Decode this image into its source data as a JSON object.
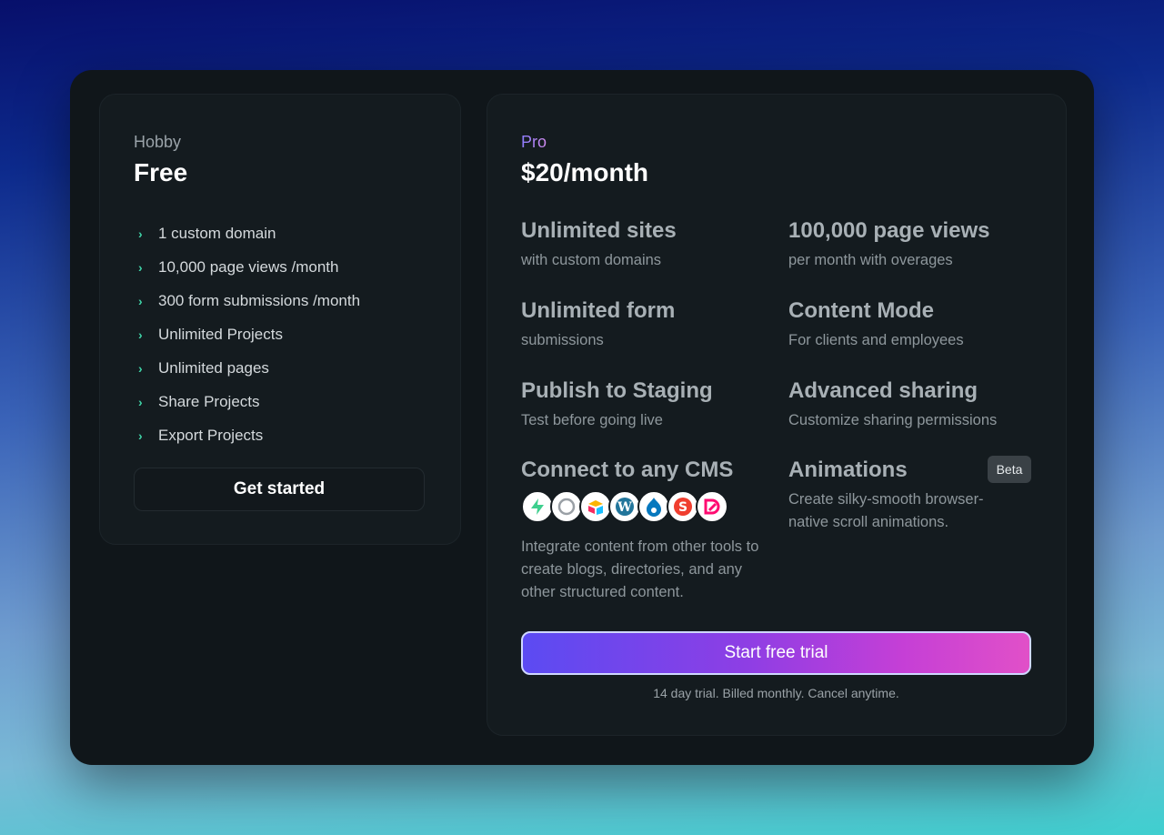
{
  "hobby": {
    "label": "Hobby",
    "price": "Free",
    "features": [
      "1 custom domain",
      "10,000 page views /month",
      "300 form submissions  /month",
      "Unlimited Projects",
      "Unlimited pages",
      "Share Projects",
      "Export Projects"
    ],
    "cta": "Get started"
  },
  "pro": {
    "label": "Pro",
    "price": "$20/month",
    "features": [
      {
        "title": "Unlimited sites",
        "sub": "with custom domains"
      },
      {
        "title": "100,000 page views",
        "sub": "per month with overages"
      },
      {
        "title": "Unlimited form",
        "sub": "submissions"
      },
      {
        "title": "Content Mode",
        "sub": "For clients and employees"
      },
      {
        "title": "Publish to Staging",
        "sub": "Test before going live"
      },
      {
        "title": "Advanced sharing",
        "sub": "Customize sharing permissions"
      },
      {
        "title": "Connect to any CMS",
        "sub": "Integrate content from other tools to create blogs, directories, and any other structured content."
      },
      {
        "title": "Animations",
        "sub": "Create silky-smooth browser-native scroll animations."
      }
    ],
    "beta_badge": "Beta",
    "cms_icons": [
      "supabase-icon",
      "contentful-icon",
      "airtable-icon",
      "wordpress-icon",
      "drupal-icon",
      "sanity-icon",
      "dato-icon"
    ],
    "cta": "Start free trial",
    "note": "14 day trial. Billed monthly. Cancel anytime."
  },
  "colors": {
    "accent_green": "#3fd3a7",
    "cta_gradient_start": "#5b4bf2",
    "cta_gradient_end": "#e150c8",
    "card_bg": "#141b1f"
  }
}
